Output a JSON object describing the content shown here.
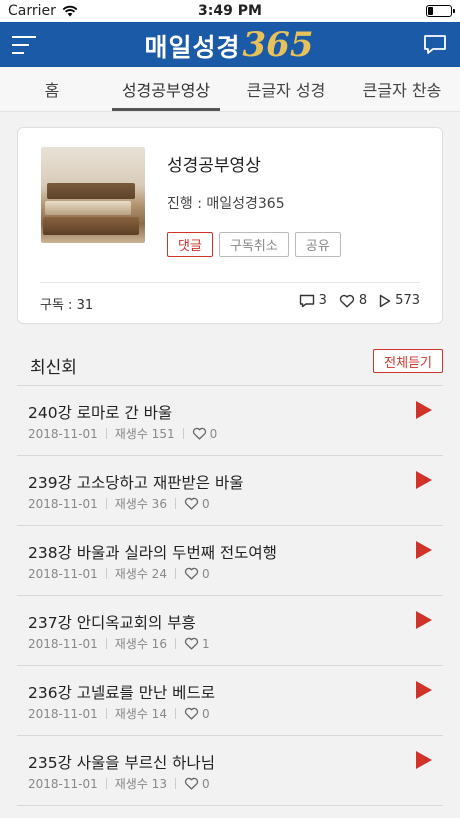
{
  "status_bar": {
    "carrier": "Carrier",
    "time": "3:49 PM",
    "battery_level": 0.25
  },
  "header": {
    "logo_text": "매일성경",
    "logo_number": "365",
    "brand_color": "#1a5aa6",
    "accent_color": "#e7c15a"
  },
  "tabs": [
    {
      "label": "홈",
      "active": false
    },
    {
      "label": "성경공부영상",
      "active": true
    },
    {
      "label": "큰글자 성경",
      "active": false
    },
    {
      "label": "큰글자 찬송",
      "active": false
    }
  ],
  "channel": {
    "title": "성경공부영상",
    "host": "진행 : 매일성경365",
    "buttons": {
      "comment": "댓글",
      "unsubscribe": "구독취소",
      "share": "공유"
    },
    "subscribers": "구독 : 31",
    "comments": "3",
    "likes": "8",
    "plays": "573"
  },
  "latest": {
    "title": "최신회",
    "play_all": "전체듣기",
    "play_color": "#d0332a",
    "episodes": [
      {
        "title": "240강 로마로 간 바울",
        "date": "2018-11-01",
        "plays": "재생수 151",
        "likes": "0"
      },
      {
        "title": "239강 고소당하고 재판받은 바울",
        "date": "2018-11-01",
        "plays": "재생수 36",
        "likes": "0"
      },
      {
        "title": "238강 바울과 실라의 두번째 전도여행",
        "date": "2018-11-01",
        "plays": "재생수 24",
        "likes": "0"
      },
      {
        "title": "237강 안디옥교회의 부흥",
        "date": "2018-11-01",
        "plays": "재생수 16",
        "likes": "1"
      },
      {
        "title": "236강 고넬료를 만난 베드로",
        "date": "2018-11-01",
        "plays": "재생수 14",
        "likes": "0"
      },
      {
        "title": "235강 사울을 부르신 하나님",
        "date": "2018-11-01",
        "plays": "재생수 13",
        "likes": "0"
      }
    ]
  }
}
